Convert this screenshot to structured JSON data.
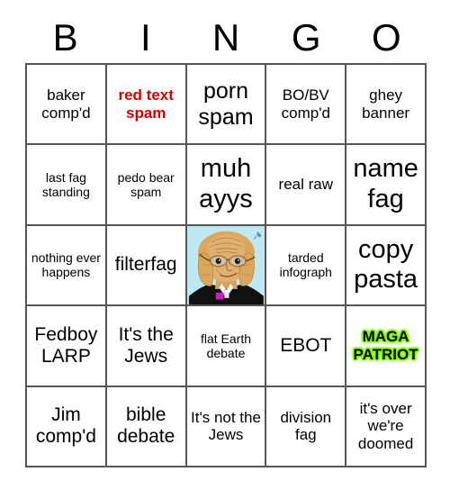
{
  "card": {
    "title": "BINGO",
    "header_letters": [
      "B",
      "I",
      "N",
      "G",
      "O"
    ],
    "grid_rows": 5,
    "grid_cols": 5,
    "border_color": "#555555",
    "background_color": "#ffffff"
  },
  "cells": [
    {
      "id": "b1",
      "text": "baker comp'd",
      "style": "plain",
      "size": "sm"
    },
    {
      "id": "i1",
      "text": "red text spam",
      "style": "red",
      "size": "sm",
      "color": "#d40000"
    },
    {
      "id": "n1",
      "text": "porn spam",
      "style": "plain",
      "size": "lg"
    },
    {
      "id": "g1",
      "text": "BO/BV comp'd",
      "style": "plain",
      "size": "sm"
    },
    {
      "id": "o1",
      "text": "ghey banner",
      "style": "plain",
      "size": "sm"
    },
    {
      "id": "b2",
      "text": "last fag standing",
      "style": "plain",
      "size": "xs"
    },
    {
      "id": "i2",
      "text": "pedo bear spam",
      "style": "plain",
      "size": "xs"
    },
    {
      "id": "n2",
      "text": "muh ayys",
      "style": "plain",
      "size": "xl"
    },
    {
      "id": "g2",
      "text": "real raw",
      "style": "plain",
      "size": "sm"
    },
    {
      "id": "o2",
      "text": "name fag",
      "style": "plain",
      "size": "xl"
    },
    {
      "id": "b3",
      "text": "nothing ever happens",
      "style": "plain",
      "size": "xs"
    },
    {
      "id": "i3",
      "text": "filterfag",
      "style": "plain",
      "size": "md"
    },
    {
      "id": "n3",
      "text": "",
      "style": "image",
      "size": "sm",
      "image_name": "judge-wojak-illustration"
    },
    {
      "id": "g3",
      "text": "tarded infograph",
      "style": "plain",
      "size": "xs"
    },
    {
      "id": "o3",
      "text": "copy pasta",
      "style": "plain",
      "size": "xl"
    },
    {
      "id": "b4",
      "text": "Fedboy LARP",
      "style": "plain",
      "size": "md"
    },
    {
      "id": "i4",
      "text": "It's the Jews",
      "style": "plain",
      "size": "md"
    },
    {
      "id": "n4",
      "text": "flat Earth debate",
      "style": "plain",
      "size": "xs"
    },
    {
      "id": "g4",
      "text": "EBOT",
      "style": "plain",
      "size": "md"
    },
    {
      "id": "o4",
      "text": "MAGA PATRIOT",
      "style": "green",
      "size": "sm",
      "color": "#7CFC00"
    },
    {
      "id": "b5",
      "text": "Jim comp'd",
      "style": "plain",
      "size": "md"
    },
    {
      "id": "i5",
      "text": "bible debate",
      "style": "plain",
      "size": "md"
    },
    {
      "id": "n5",
      "text": "It's not the Jews",
      "style": "plain",
      "size": "sm"
    },
    {
      "id": "g5",
      "text": "division fag",
      "style": "plain",
      "size": "sm"
    },
    {
      "id": "o5",
      "text": "it's over we're doomed",
      "style": "plain",
      "size": "sm"
    }
  ],
  "image_cell": {
    "name": "judge-wojak-illustration",
    "background_color": "#bfe9f2",
    "wig_color": "#dba75c",
    "wig_shade": "#b8873f",
    "robe_color": "#111111",
    "collar_color": "#ffffff",
    "bowtie_color": "#c720c7",
    "glasses_color": "#7a4a1e",
    "watermark": "pin-marker"
  }
}
